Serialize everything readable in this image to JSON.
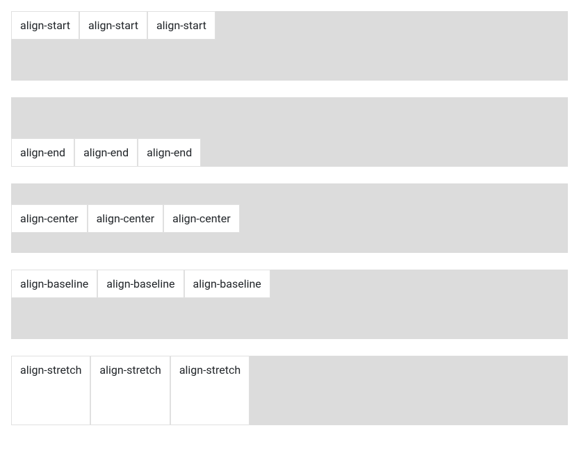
{
  "rows": [
    {
      "label": "align-start"
    },
    {
      "label": "align-end"
    },
    {
      "label": "align-center"
    },
    {
      "label": "align-baseline"
    },
    {
      "label": "align-stretch"
    }
  ]
}
